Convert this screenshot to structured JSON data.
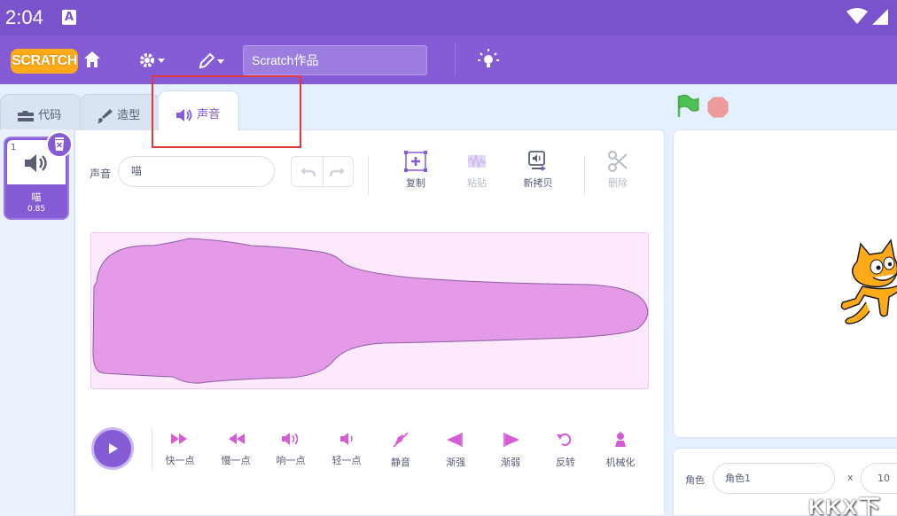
{
  "status_bar": {
    "time": "2:04",
    "notification_letter": "A"
  },
  "menu_bar": {
    "logo_text": "SCRATCH",
    "project_title": "Scratch作品"
  },
  "tabs": [
    {
      "label": "代码",
      "icon": "code-icon",
      "active": false
    },
    {
      "label": "造型",
      "icon": "brush-icon",
      "active": false
    },
    {
      "label": "声音",
      "icon": "speaker-icon",
      "active": true
    }
  ],
  "sound_list": {
    "items": [
      {
        "number": "1",
        "name": "喵",
        "duration": "0.85"
      }
    ]
  },
  "editor": {
    "sound_label": "声音",
    "sound_name": "喵",
    "tools": [
      {
        "label": "复制",
        "icon": "copy-icon",
        "enabled": true
      },
      {
        "label": "粘贴",
        "icon": "paste-icon",
        "enabled": false
      },
      {
        "label": "新拷贝",
        "icon": "new-copy-icon",
        "enabled": true
      },
      {
        "label": "删除",
        "icon": "scissors-icon",
        "enabled": false
      }
    ],
    "effects": [
      {
        "label": "快一点",
        "icon": "faster-icon"
      },
      {
        "label": "慢一点",
        "icon": "slower-icon"
      },
      {
        "label": "响一点",
        "icon": "louder-icon"
      },
      {
        "label": "轻一点",
        "icon": "softer-icon"
      },
      {
        "label": "静音",
        "icon": "mute-icon"
      },
      {
        "label": "渐强",
        "icon": "fade-in-icon"
      },
      {
        "label": "渐弱",
        "icon": "fade-out-icon"
      },
      {
        "label": "反转",
        "icon": "reverse-icon"
      },
      {
        "label": "机械化",
        "icon": "robot-icon"
      }
    ]
  },
  "sprite_info": {
    "sprite_label": "角色",
    "sprite_name": "角色1",
    "x_label": "x",
    "x_value": "10"
  },
  "watermark": "KKX下",
  "colors": {
    "primary": "#855cd6",
    "status_bar": "#7a53cc",
    "waveform": "#e59ae7",
    "highlight": "#e23a3a"
  }
}
